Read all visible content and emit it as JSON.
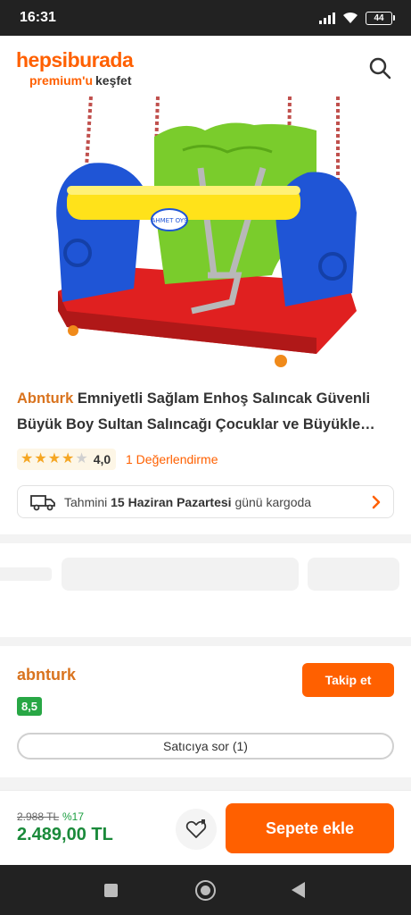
{
  "status_bar": {
    "time": "16:31",
    "battery": "44"
  },
  "header": {
    "logo": "hepsiburada",
    "premium": "premium'u",
    "kesfet": "keşfet"
  },
  "product": {
    "brand": "Abnturk",
    "title_line1_rest": "Emniyetli Sağlam Enhoş Salıncak Güvenli",
    "title_line2": "Büyük Boy Sultan Salıncağı Çocuklar ve Büyükle…",
    "rating": 4,
    "rating_text": "4,0",
    "reviews": "1 Değerlendirme",
    "image_logo_text": "AHMET OYS"
  },
  "shipping": {
    "prefix": "Tahmini",
    "date": "15 Haziran Pazartesi",
    "suffix": "günü kargoda"
  },
  "seller": {
    "name": "abnturk",
    "follow_label": "Takip et",
    "score": "8,5",
    "ask_label": "Satıcıya sor (1)"
  },
  "bottom": {
    "old_price": "2.988 TL",
    "discount": "%17",
    "price": "2.489,00 TL",
    "cart_label": "Sepete ekle"
  },
  "colors": {
    "brand_orange": "#ff6000",
    "price_green": "#1a8a3a",
    "score_green": "#28a745"
  }
}
